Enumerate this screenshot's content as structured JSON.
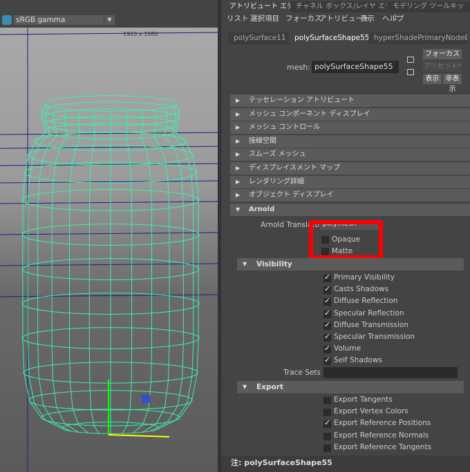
{
  "viewport": {
    "color_space": "sRGB gamma",
    "resolution": "1920 x 1080",
    "wire_color": "#3df0a8"
  },
  "top_tabs": [
    "アトリビュート エディタ",
    "チャネル ボックス/レイヤ エディタ",
    "モデリング ツールキット"
  ],
  "menu": [
    "リスト",
    "選択項目",
    "フォーカス",
    "アトリビュート",
    "表示",
    "ヘルプ"
  ],
  "node_tabs": [
    "polySurface11",
    "polySurfaceShape55",
    "hyperShadePrimaryNodeEd"
  ],
  "mesh": {
    "label": "mesh:",
    "value": "polySurfaceShape55"
  },
  "buttons": {
    "focus": "フォーカス",
    "preset": "プリセット*",
    "show": "表示",
    "hide": "非表示"
  },
  "sections": [
    "テッセレーション アトリビュート",
    "メッシュ コンポーネント ディスプレイ",
    "メッシュ コントロール",
    "接線空間",
    "スムーズ メッシュ",
    "ディスプレイスメント マップ",
    "レンダリング詳細",
    "オブジェクト ディスプレイ"
  ],
  "arnold": {
    "title": "Arnold",
    "translator_label": "Arnold Translator",
    "translator_value": "polymesh",
    "opaque": {
      "label": "Opaque",
      "checked": false
    },
    "matte": {
      "label": "Matte",
      "checked": false
    }
  },
  "visibility": {
    "title": "Visibility",
    "items": [
      {
        "label": "Primary Visibility",
        "checked": true
      },
      {
        "label": "Casts Shadows",
        "checked": true
      },
      {
        "label": "Diffuse Reflection",
        "checked": true
      },
      {
        "label": "Specular Reflection",
        "checked": true
      },
      {
        "label": "Diffuse Transmission",
        "checked": true
      },
      {
        "label": "Specular Transmission",
        "checked": true
      },
      {
        "label": "Volume",
        "checked": true
      },
      {
        "label": "Self Shadows",
        "checked": true
      }
    ],
    "trace_sets_label": "Trace Sets",
    "trace_sets_value": ""
  },
  "export": {
    "title": "Export",
    "items": [
      {
        "label": "Export Tangents",
        "checked": false
      },
      {
        "label": "Export Vertex Colors",
        "checked": false
      },
      {
        "label": "Export Reference Positions",
        "checked": true
      },
      {
        "label": "Export Reference Normals",
        "checked": false
      },
      {
        "label": "Export Reference Tangents",
        "checked": false
      }
    ]
  },
  "status": "注: polySurfaceShape55",
  "highlight_color": "#ff0000"
}
